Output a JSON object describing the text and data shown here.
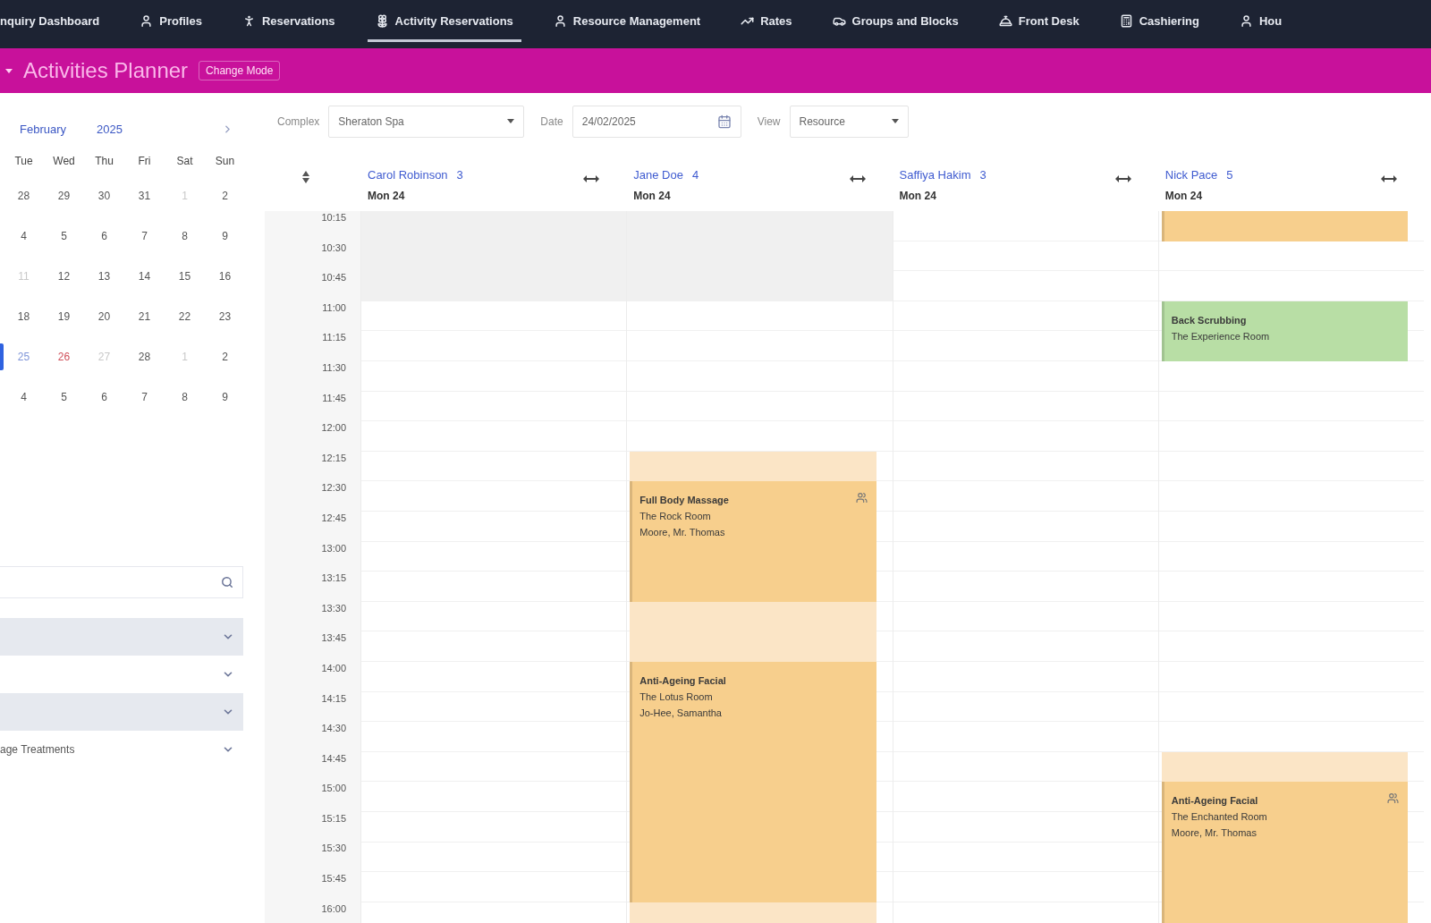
{
  "top_nav": {
    "items": [
      {
        "label": "nquiry Dashboard",
        "selected": false
      },
      {
        "label": "Profiles",
        "selected": false
      },
      {
        "label": "Reservations",
        "selected": false
      },
      {
        "label": "Activity Reservations",
        "selected": true
      },
      {
        "label": "Resource Management",
        "selected": false
      },
      {
        "label": "Rates",
        "selected": false
      },
      {
        "label": "Groups and Blocks",
        "selected": false
      },
      {
        "label": "Front Desk",
        "selected": false
      },
      {
        "label": "Cashiering",
        "selected": false
      },
      {
        "label": "Hou",
        "selected": false
      }
    ]
  },
  "header": {
    "title": "Activities Planner",
    "mode": "Change Mode"
  },
  "calendar": {
    "month": "February",
    "year": "2025",
    "weekdays": [
      "Tue",
      "Wed",
      "Thu",
      "Fri",
      "Sat",
      "Sun"
    ],
    "weeks": [
      {
        "selected": false,
        "days": [
          {
            "day": "28",
            "muted": false
          },
          {
            "day": "29",
            "muted": false
          },
          {
            "day": "30",
            "muted": false
          },
          {
            "day": "31",
            "muted": false
          },
          {
            "day": "1",
            "muted": true
          },
          {
            "day": "2",
            "muted": false
          }
        ]
      },
      {
        "selected": false,
        "days": [
          {
            "day": "4",
            "muted": false
          },
          {
            "day": "5",
            "muted": false
          },
          {
            "day": "6",
            "muted": false
          },
          {
            "day": "7",
            "muted": false
          },
          {
            "day": "8",
            "muted": false
          },
          {
            "day": "9",
            "muted": false
          }
        ]
      },
      {
        "selected": false,
        "days": [
          {
            "day": "11",
            "muted": true
          },
          {
            "day": "12",
            "muted": false
          },
          {
            "day": "13",
            "muted": false
          },
          {
            "day": "14",
            "muted": false
          },
          {
            "day": "15",
            "muted": false
          },
          {
            "day": "16",
            "muted": false
          }
        ]
      },
      {
        "selected": false,
        "days": [
          {
            "day": "18",
            "muted": false
          },
          {
            "day": "19",
            "muted": false
          },
          {
            "day": "20",
            "muted": false
          },
          {
            "day": "21",
            "muted": false
          },
          {
            "day": "22",
            "muted": false
          },
          {
            "day": "23",
            "muted": false
          }
        ]
      },
      {
        "selected": true,
        "days": [
          {
            "day": "25",
            "muted": false,
            "color": "#7f95d8"
          },
          {
            "day": "26",
            "muted": false,
            "color": "#d0505a"
          },
          {
            "day": "27",
            "muted": true
          },
          {
            "day": "28",
            "muted": false
          },
          {
            "day": "1",
            "muted": true
          },
          {
            "day": "2",
            "muted": false
          }
        ]
      },
      {
        "selected": false,
        "days": [
          {
            "day": "4",
            "muted": false
          },
          {
            "day": "5",
            "muted": false
          },
          {
            "day": "6",
            "muted": false
          },
          {
            "day": "7",
            "muted": false
          },
          {
            "day": "8",
            "muted": false
          },
          {
            "day": "9",
            "muted": false
          }
        ]
      }
    ]
  },
  "filters": [
    {
      "shaded": true
    },
    {
      "shaded": false
    },
    {
      "shaded": true
    },
    {
      "label": "age Treatments",
      "shaded": false
    }
  ],
  "toolbar": {
    "complex_label": "Complex",
    "complex": "Sheraton Spa",
    "date_label": "Date",
    "date": "24/02/2025",
    "view_label": "View",
    "view": "Resource"
  },
  "schedule": {
    "slots": [
      "10:15",
      "10:30",
      "10:45",
      "11:00",
      "11:15",
      "11:30",
      "11:45",
      "12:00",
      "12:15",
      "12:30",
      "12:45",
      "13:00",
      "13:15",
      "13:30",
      "13:45",
      "14:00",
      "14:15",
      "14:30",
      "14:45",
      "15:00",
      "15:15",
      "15:30",
      "15:45",
      "16:00"
    ],
    "resources": [
      {
        "name": "Carol Robinson",
        "count": "3",
        "day": "Mon 24",
        "cells": [
          {
            "kind": "blocked"
          },
          {
            "kind": "more"
          },
          {
            "kind": "more"
          }
        ]
      },
      {
        "name": "Jane Doe",
        "count": "4",
        "day": "Mon 24",
        "cells": [
          {
            "kind": "blocked"
          },
          {
            "kind": "more"
          },
          {
            "kind": "more"
          },
          {
            "kind": "free"
          },
          {
            "kind": "free"
          },
          {
            "kind": "free"
          },
          {
            "kind": "free"
          },
          {
            "kind": "free"
          },
          {
            "kind": "buffer"
          },
          {
            "kind": "booking",
            "color": "#f7cf8d",
            "group": true,
            "title": "Full Body Massage",
            "room": "The Rock Room",
            "guest": "Moore, Mr. Thomas"
          },
          {
            "kind": "more"
          },
          {
            "kind": "more"
          },
          {
            "kind": "more"
          },
          {
            "kind": "buffer"
          },
          {
            "kind": "more"
          },
          {
            "kind": "booking",
            "color": "#f7cf8d",
            "group": false,
            "title": "Anti-Ageing Facial",
            "room": "The Lotus Room",
            "guest": "Jo-Hee, Samantha"
          },
          {
            "kind": "more"
          },
          {
            "kind": "more"
          },
          {
            "kind": "more"
          },
          {
            "kind": "more"
          },
          {
            "kind": "more"
          },
          {
            "kind": "more"
          },
          {
            "kind": "more"
          },
          {
            "kind": "buffer"
          }
        ]
      },
      {
        "name": "Saffiya Hakim",
        "count": "3",
        "day": "Mon 24"
      },
      {
        "name": "Nick Pace",
        "count": "5",
        "day": "Mon 24",
        "cells": [
          {
            "kind": "booking",
            "color": "#f7cf8d",
            "group": false
          },
          {
            "kind": "free"
          },
          {
            "kind": "free"
          },
          {
            "kind": "booking",
            "color": "#b8dea5",
            "group": false,
            "title": "Back Scrubbing",
            "room": "The Experience Room"
          },
          {
            "kind": "more"
          },
          {
            "kind": "free"
          },
          {
            "kind": "free"
          },
          {
            "kind": "free"
          },
          {
            "kind": "free"
          },
          {
            "kind": "free"
          },
          {
            "kind": "free"
          },
          {
            "kind": "free"
          },
          {
            "kind": "free"
          },
          {
            "kind": "free"
          },
          {
            "kind": "free"
          },
          {
            "kind": "free"
          },
          {
            "kind": "free"
          },
          {
            "kind": "free"
          },
          {
            "kind": "buffer"
          },
          {
            "kind": "booking",
            "color": "#f7cf8d",
            "group": true,
            "title": "Anti-Ageing Facial",
            "room": "The Enchanted Room",
            "guest": "Moore, Mr. Thomas"
          },
          {
            "kind": "more"
          },
          {
            "kind": "more"
          },
          {
            "kind": "more"
          },
          {
            "kind": "more"
          }
        ]
      }
    ]
  }
}
